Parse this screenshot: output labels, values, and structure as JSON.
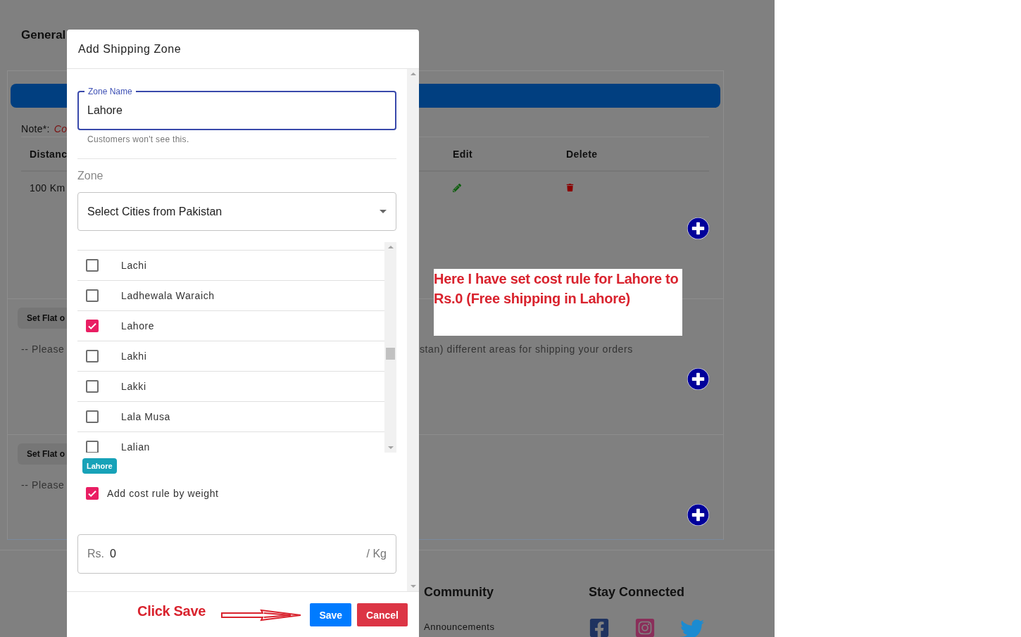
{
  "page": {
    "heading": "General",
    "note_label": "Note*:",
    "note_text": "Co",
    "table": {
      "columns": [
        "Distanc",
        "Edit",
        "Delete"
      ],
      "rows": [
        {
          "distance": "100 Km"
        }
      ]
    },
    "sections": [
      {
        "button": "Set Flat o",
        "hint": "-- Please",
        "hint_continued": "stan) different areas for shipping your orders"
      },
      {
        "button": "Set Flat o",
        "hint": "-- Please"
      }
    ]
  },
  "footer": {
    "columns": [
      {
        "title": "Community",
        "links": [
          "Announcements"
        ]
      },
      {
        "title": "Stay Connected",
        "social": [
          {
            "kind": "facebook"
          },
          {
            "kind": "instagram"
          },
          {
            "kind": "twitter"
          }
        ]
      }
    ]
  },
  "dialog": {
    "title": "Add Shipping Zone",
    "zone_name": {
      "label": "Zone Name",
      "value": "Lahore",
      "helper": "Customers won't see this."
    },
    "zone_label": "Zone",
    "select": {
      "value": "Select Cities from Pakistan"
    },
    "cities": [
      {
        "name": "Lachi",
        "checked": false
      },
      {
        "name": "Ladhewala Waraich",
        "checked": false
      },
      {
        "name": "Lahore",
        "checked": true
      },
      {
        "name": "Lakhi",
        "checked": false
      },
      {
        "name": "Lakki",
        "checked": false
      },
      {
        "name": "Lala Musa",
        "checked": false
      },
      {
        "name": "Lalian",
        "checked": false
      }
    ],
    "chips": [
      "Lahore"
    ],
    "weight_rule": {
      "label": "Add cost rule by weight",
      "checked": true
    },
    "cost": {
      "prefix": "Rs.",
      "value": "0",
      "suffix": "/ Kg"
    },
    "buttons": [
      {
        "kind": "save",
        "label": "Save"
      },
      {
        "kind": "cancel",
        "label": "Cancel"
      }
    ]
  },
  "annotations": {
    "note": "Here I have set cost rule for Lahore to Rs.0 (Free shipping in Lahore)",
    "callout": "Click Save"
  }
}
